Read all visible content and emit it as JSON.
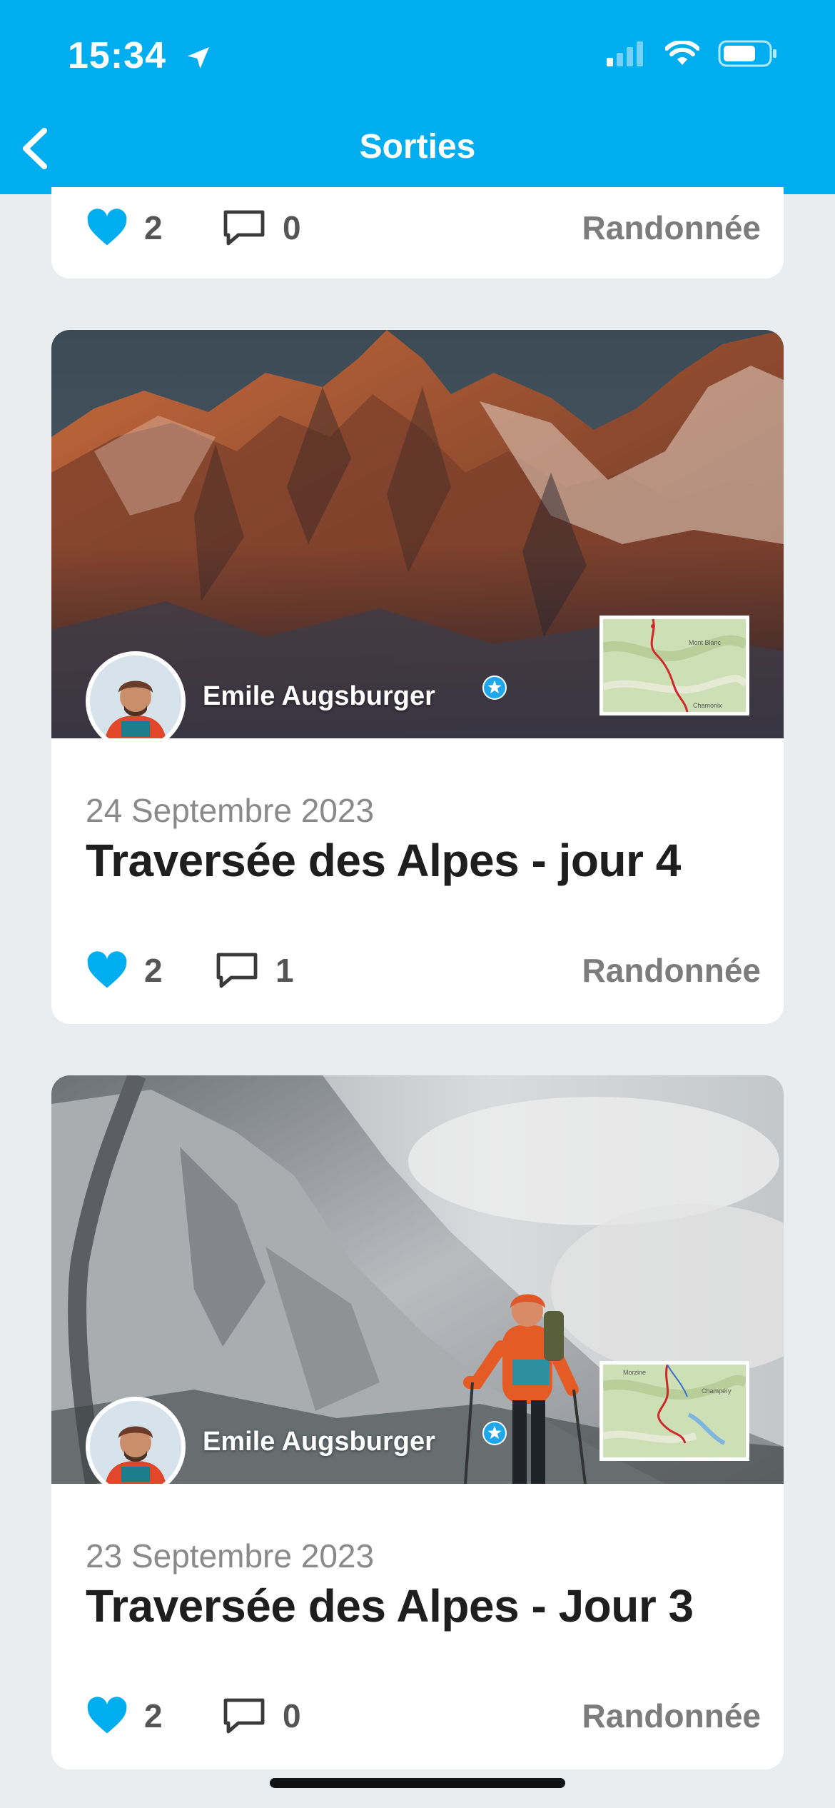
{
  "status": {
    "time": "15:34"
  },
  "header": {
    "title": "Sorties"
  },
  "colors": {
    "accent": "#00aeef",
    "like": "#00aeef",
    "card_bg": "#ffffff",
    "page_bg": "#e9edf0"
  },
  "partial_card": {
    "likes": "2",
    "comments": "0",
    "category": "Randonnée"
  },
  "cards": [
    {
      "author": "Emile Augsburger",
      "date": "24 Septembre 2023",
      "title": "Traversée des Alpes - jour 4",
      "likes": "2",
      "comments": "1",
      "category": "Randonnée",
      "hero": "mountain-sunset-photo",
      "map_label_1": "Mont Blanc",
      "map_label_2": "Chamonix"
    },
    {
      "author": "Emile Augsburger",
      "date": "23 Septembre 2023",
      "title": "Traversée des Alpes - Jour 3",
      "likes": "2",
      "comments": "0",
      "category": "Randonnée",
      "hero": "snowy-ridge-hiker-photo",
      "map_label_1": "Morzine",
      "map_label_2": "Champéry"
    }
  ]
}
